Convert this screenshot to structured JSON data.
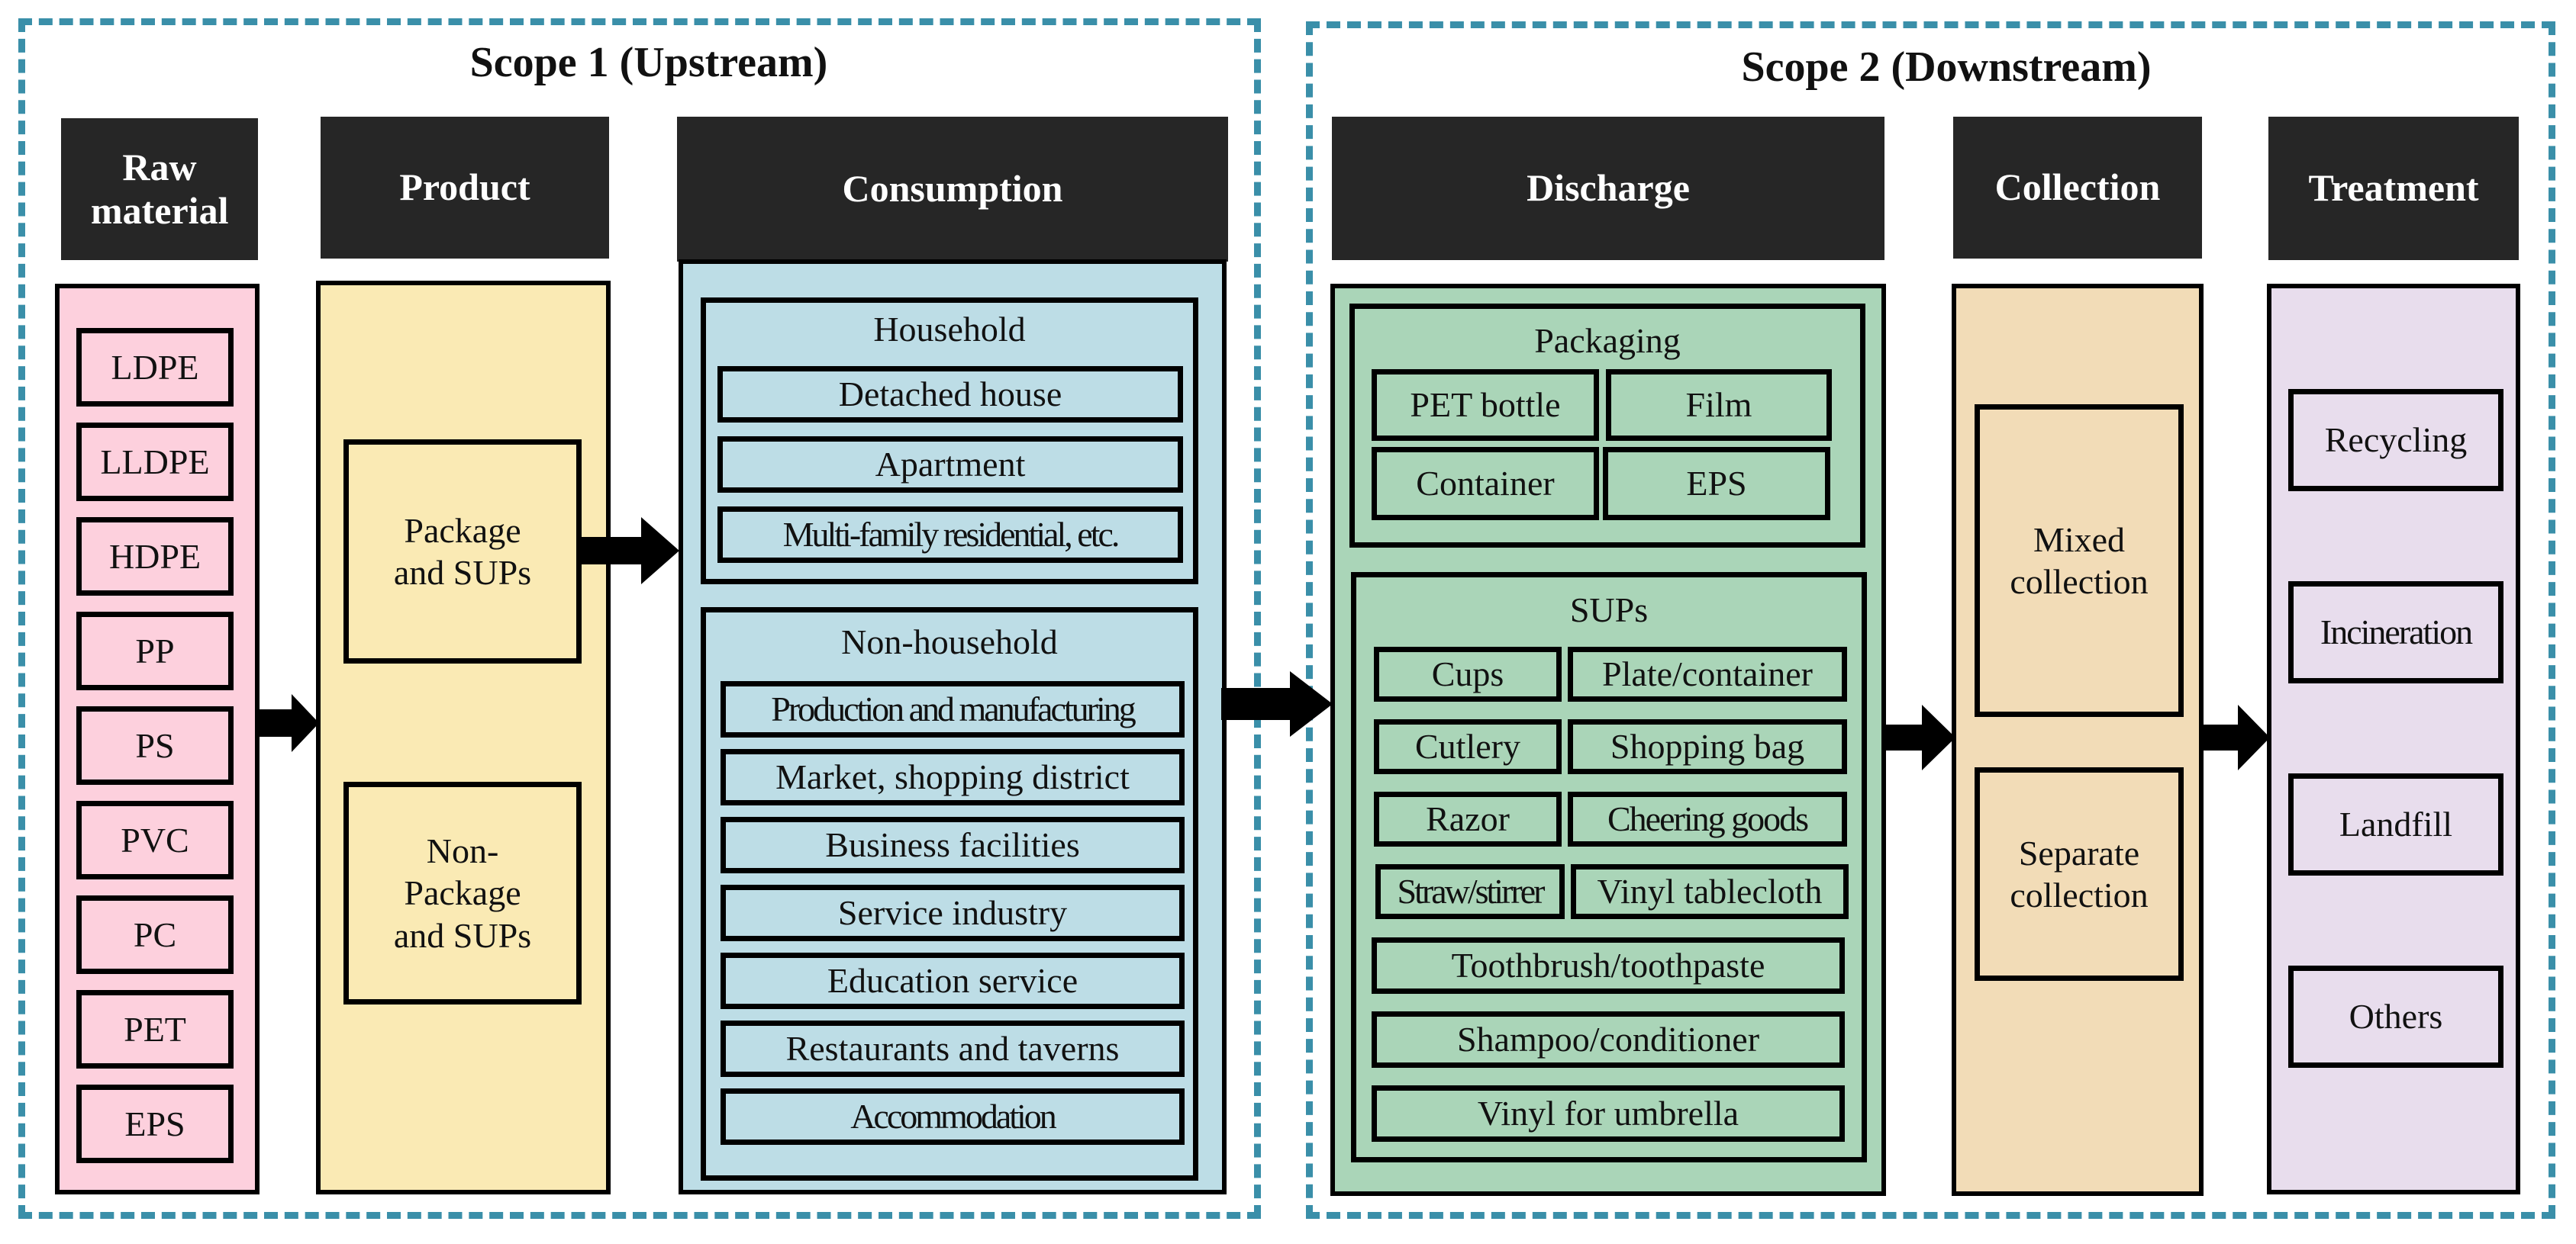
{
  "scopes": {
    "scope1_title": "Scope 1 (Upstream)",
    "scope2_title": "Scope 2 (Downstream)",
    "border_color": "#3a8fa9"
  },
  "columns": {
    "raw_material": {
      "header": "Raw material",
      "color": "#fdd0dd",
      "items": [
        "LDPE",
        "LLDPE",
        "HDPE",
        "PP",
        "PS",
        "PVC",
        "PC",
        "PET",
        "EPS"
      ]
    },
    "product": {
      "header": "Product",
      "color": "#faeab4",
      "items": [
        "Package and SUPs",
        "Non-Package and SUPs"
      ]
    },
    "consumption": {
      "header": "Consumption",
      "color": "#bddde6",
      "groups": [
        {
          "title": "Household",
          "items": [
            "Detached house",
            "Apartment",
            "Multi-family residential, etc."
          ]
        },
        {
          "title": "Non-household",
          "items": [
            "Production and manufacturing",
            "Market, shopping district",
            "Business facilities",
            "Service industry",
            "Education service",
            "Restaurants and taverns",
            "Accommodation"
          ]
        }
      ]
    },
    "discharge": {
      "header": "Discharge",
      "color": "#aad5b8",
      "packaging": {
        "title": "Packaging",
        "items": [
          "PET bottle",
          "Film",
          "Container",
          "EPS"
        ]
      },
      "sups": {
        "title": "SUPs",
        "pair_items": [
          "Cups",
          "Plate/container",
          "Cutlery",
          "Shopping bag",
          "Razor",
          "Cheering goods",
          "Straw/stirrer",
          "Vinyl tablecloth"
        ],
        "wide_items": [
          "Toothbrush/toothpaste",
          "Shampoo/conditioner",
          "Vinyl for umbrella"
        ]
      }
    },
    "collection": {
      "header": "Collection",
      "color": "#f2dcb7",
      "items": [
        "Mixed collection",
        "Separate collection"
      ]
    },
    "treatment": {
      "header": "Treatment",
      "color": "#e8dded",
      "items": [
        "Recycling",
        "Incineration",
        "Landfill",
        "Others"
      ]
    }
  }
}
